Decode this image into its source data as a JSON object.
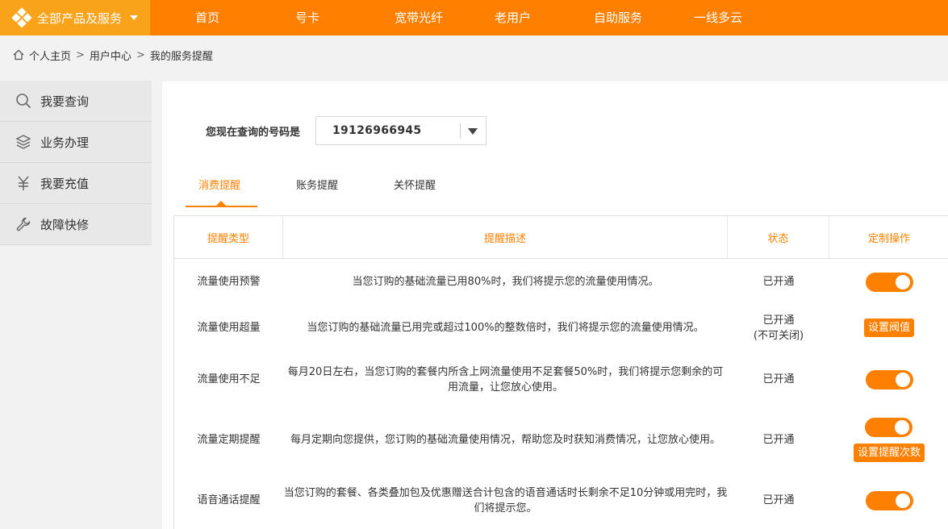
{
  "topnav": {
    "all_products": "全部产品及服务",
    "items": [
      "首页",
      "号卡",
      "宽带光纤",
      "老用户",
      "自助服务",
      "一线多云"
    ]
  },
  "breadcrumb": [
    "个人主页",
    "用户中心",
    "我的服务提醒"
  ],
  "breadcrumb_sep": ">",
  "sidebar": {
    "items": [
      {
        "label": "我要查询",
        "icon": "search-icon"
      },
      {
        "label": "业务办理",
        "icon": "layers-icon"
      },
      {
        "label": "我要充值",
        "icon": "yuan-icon"
      },
      {
        "label": "故障快修",
        "icon": "wrench-icon"
      }
    ]
  },
  "query": {
    "label": "您现在查询的号码是",
    "phone": "19126966945"
  },
  "tabs": [
    {
      "label": "消费提醒",
      "active": true
    },
    {
      "label": "账务提醒",
      "active": false
    },
    {
      "label": "关怀提醒",
      "active": false
    }
  ],
  "table": {
    "headers": [
      "提醒类型",
      "提醒描述",
      "状态",
      "定制操作"
    ],
    "rows": [
      {
        "type": "流量使用预警",
        "desc": "当您订购的基础流量已用80%时，我们将提示您的流量使用情况。",
        "status": "已开通",
        "status2": "",
        "toggle": true,
        "button": ""
      },
      {
        "type": "流量使用超量",
        "desc": "当您订购的基础流量已用完或超过100%的整数倍时，我们将提示您的流量使用情况。",
        "status": "已开通",
        "status2": "(不可关闭)",
        "toggle": false,
        "button": "设置阀值"
      },
      {
        "type": "流量使用不足",
        "desc": "每月20日左右，当您订购的套餐内所含上网流量使用不足套餐50%时，我们将提示您剩余的可用流量，让您放心使用。",
        "status": "已开通",
        "status2": "",
        "toggle": true,
        "button": ""
      },
      {
        "type": "流量定期提醒",
        "desc": "每月定期向您提供，您订购的基础流量使用情况，帮助您及时获知消费情况，让您放心使用。",
        "status": "已开通",
        "status2": "",
        "toggle": true,
        "button": "设置提醒次数"
      },
      {
        "type": "语音通话提醒",
        "desc": "当您订购的套餐、各类叠加包及优惠赠送合计包含的语音通话时长剩余不足10分钟或用完时，我们将提示您。",
        "status": "已开通",
        "status2": "",
        "toggle": true,
        "button": ""
      }
    ]
  },
  "colors": {
    "accent": "#ff8000",
    "accent_light": "#f9a31b"
  }
}
